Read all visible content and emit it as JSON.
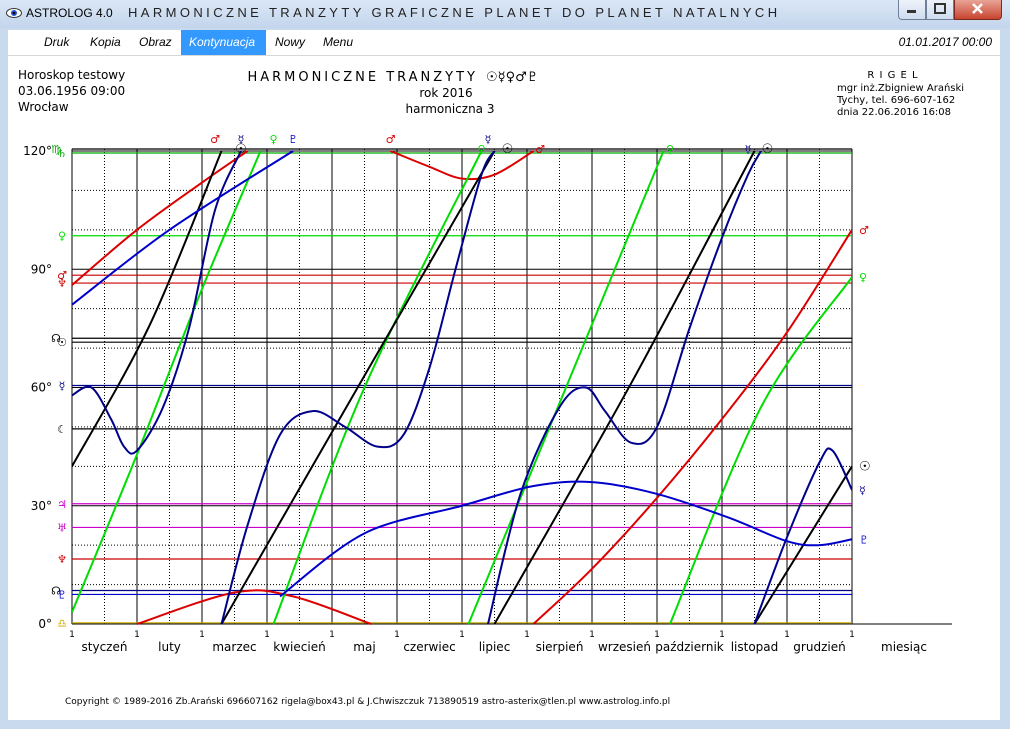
{
  "window": {
    "app_name": "ASTROLOG 4.0",
    "title": "HARMONICZNE TRANZYTY GRAFICZNE PLANET DO PLANET NATALNYCH",
    "minimize_glyph": "—",
    "maximize_glyph": "□",
    "close_glyph": "✕"
  },
  "menu": {
    "items": [
      {
        "label": "Druk"
      },
      {
        "label": "Kopia"
      },
      {
        "label": "Obraz"
      },
      {
        "label": "Kontynuacja",
        "active": true
      },
      {
        "label": "Nowy"
      },
      {
        "label": "Menu"
      }
    ],
    "datetime": "01.01.2017  00:00"
  },
  "header": {
    "left": [
      "Horoskop testowy",
      "03.06.1956  09:00",
      "Wrocław"
    ],
    "center_title": "HARMONICZNE  TRANZYTY",
    "center_title_glyphs": "☉☿♀♂♇",
    "center_year": "rok  2016",
    "center_harmonic": "harmoniczna 3",
    "right": [
      "R I G E L",
      "mgr inż.Zbigniew Arański",
      "Tychy, tel. 696-607-162",
      "dnia 22.06.2016  16:08"
    ]
  },
  "footer": {
    "copyright": "Copyright © 1989-2016 Zb.Arański 696607162 rigela@box43.pl & J.Chwiszczuk 713890519 astro-asterix@tlen.pl www.astrolog.info.pl"
  },
  "colors": {
    "sun": "#000000",
    "moon": "#000000",
    "mercury": "#00008b",
    "venus": "#00dd00",
    "mars": "#dd0000",
    "pluto": "#0000cc",
    "jupiter": "#cc00cc",
    "saturn": "#00aa00",
    "uranus": "#cc00cc",
    "neptune": "#cc0000",
    "node": "#cc00cc",
    "asc": "#ccaa00"
  },
  "chart_data": {
    "type": "line",
    "x_unit": "month",
    "xlim": [
      0,
      12
    ],
    "ylim": [
      0,
      120
    ],
    "grid": true,
    "xlabel": "miesiąc",
    "y_ticks": [
      {
        "value": 0,
        "label": "0°"
      },
      {
        "value": 30,
        "label": "30°"
      },
      {
        "value": 60,
        "label": "60°"
      },
      {
        "value": 90,
        "label": "90°"
      },
      {
        "value": 120,
        "label": "120°"
      }
    ],
    "x_tick_label": "1",
    "months": [
      "styczeń",
      "luty",
      "marzec",
      "kwiecień",
      "maj",
      "czerwiec",
      "lipiec",
      "sierpień",
      "wrzesień",
      "październik",
      "listopad",
      "grudzień"
    ],
    "natal_lines": [
      {
        "value": 120.5,
        "color": "#000000",
        "glyph": "♍",
        "glyph_color": "#00aa00",
        "label_x_offset": -6
      },
      {
        "value": 119.5,
        "color": "#00aa00",
        "glyph": "♄",
        "glyph_color": "#00aa00"
      },
      {
        "value": 98.5,
        "color": "#00dd00",
        "glyph": "♀",
        "glyph_color": "#00dd00"
      },
      {
        "value": 88.5,
        "color": "#cc0000",
        "glyph": "♂",
        "glyph_color": "#cc0000"
      },
      {
        "value": 86.5,
        "color": "#cc0000",
        "glyph": "♆",
        "glyph_color": "#cc0000"
      },
      {
        "value": 72.5,
        "color": "#000000",
        "glyph": "☊",
        "glyph_color": "#000000",
        "label_x_offset": -6
      },
      {
        "value": 71.5,
        "color": "#000000",
        "glyph": "☉",
        "glyph_color": "#000000"
      },
      {
        "value": 60.5,
        "color": "#00008b",
        "glyph": "☿",
        "glyph_color": "#00008b"
      },
      {
        "value": 49.5,
        "color": "#000000",
        "glyph": "☾",
        "glyph_color": "#000000"
      },
      {
        "value": 30.5,
        "color": "#cc00cc",
        "glyph": "♃",
        "glyph_color": "#cc00cc"
      },
      {
        "value": 24.5,
        "color": "#cc00cc",
        "glyph": "♅",
        "glyph_color": "#cc00cc"
      },
      {
        "value": 16.5,
        "color": "#cc0000",
        "glyph": "♆",
        "glyph_color": "#cc0000"
      },
      {
        "value": 8.5,
        "color": "#000080",
        "glyph": "☊",
        "glyph_color": "#000000",
        "label_x_offset": -6
      },
      {
        "value": 7.5,
        "color": "#0000cc",
        "glyph": "♇",
        "glyph_color": "#0000cc"
      },
      {
        "value": 0.3,
        "color": "#ccaa00",
        "glyph": "♎",
        "glyph_color": "#ccaa00"
      }
    ],
    "series": [
      {
        "planet": "mars",
        "glyph": "♂",
        "color": "#dd0000",
        "segments": [
          [
            [
              0,
              86
            ],
            [
              1,
              100
            ],
            [
              2,
              112
            ],
            [
              2.7,
              120
            ]
          ],
          [
            [
              4.9,
              120
            ],
            [
              5.5,
              116
            ],
            [
              6.0,
              113
            ],
            [
              6.5,
              114
            ],
            [
              7.1,
              120
            ]
          ],
          [
            [
              1.0,
              0
            ],
            [
              2.5,
              8
            ],
            [
              3.4,
              7
            ],
            [
              4.6,
              0
            ]
          ],
          [
            [
              7.1,
              0
            ],
            [
              8.0,
              14
            ],
            [
              9.0,
              32
            ],
            [
              10.0,
              52
            ],
            [
              11.0,
              74
            ],
            [
              12.0,
              100
            ]
          ]
        ]
      },
      {
        "planet": "venus",
        "glyph": "♀",
        "color": "#00dd00",
        "segments": [
          [
            [
              0,
              3
            ],
            [
              1,
              43
            ],
            [
              2,
              85
            ],
            [
              2.9,
              120
            ]
          ],
          [
            [
              3.1,
              0
            ],
            [
              4.5,
              60
            ],
            [
              6.3,
              120
            ]
          ],
          [
            [
              6.1,
              0
            ],
            [
              7.6,
              60
            ],
            [
              9.1,
              120
            ]
          ],
          [
            [
              9.2,
              0
            ],
            [
              10.6,
              55
            ],
            [
              12.0,
              88
            ]
          ]
        ]
      },
      {
        "planet": "sun",
        "glyph": "☉",
        "color": "#000000",
        "segments": [
          [
            [
              0,
              40
            ],
            [
              1.2,
              76
            ],
            [
              2.3,
              120
            ]
          ],
          [
            [
              2.3,
              0
            ],
            [
              4.5,
              63
            ],
            [
              6.5,
              120
            ]
          ],
          [
            [
              6.5,
              0
            ],
            [
              8.6,
              61
            ],
            [
              10.5,
              120
            ]
          ],
          [
            [
              10.5,
              0
            ],
            [
              12.0,
              40
            ]
          ]
        ]
      },
      {
        "planet": "mercury",
        "glyph": "☿",
        "color": "#00008b",
        "segments": [
          [
            [
              0,
              58
            ],
            [
              0.3,
              60
            ],
            [
              0.6,
              52
            ],
            [
              0.8,
              45
            ],
            [
              1.0,
              44
            ],
            [
              1.4,
              55
            ],
            [
              1.8,
              75
            ],
            [
              2.2,
              105
            ],
            [
              2.6,
              120
            ]
          ],
          [
            [
              2.3,
              0
            ],
            [
              2.7,
              25
            ],
            [
              3.2,
              48
            ],
            [
              3.7,
              54
            ],
            [
              4.2,
              50
            ],
            [
              4.7,
              45
            ],
            [
              5.1,
              48
            ],
            [
              5.5,
              65
            ],
            [
              5.9,
              90
            ],
            [
              6.3,
              114
            ],
            [
              6.5,
              120
            ]
          ],
          [
            [
              6.4,
              0
            ],
            [
              6.9,
              33
            ],
            [
              7.5,
              55
            ],
            [
              7.9,
              60
            ],
            [
              8.2,
              54
            ],
            [
              8.6,
              46
            ],
            [
              9.0,
              50
            ],
            [
              9.5,
              75
            ],
            [
              10.0,
              98
            ],
            [
              10.4,
              114
            ],
            [
              10.6,
              120
            ]
          ],
          [
            [
              10.5,
              0
            ],
            [
              11.0,
              22
            ],
            [
              11.5,
              41
            ],
            [
              11.7,
              44
            ],
            [
              12.0,
              34
            ]
          ]
        ]
      },
      {
        "planet": "pluto",
        "glyph": "♇",
        "color": "#0000cc",
        "segments": [
          [
            [
              0,
              81
            ],
            [
              1.5,
              100
            ],
            [
              3.4,
              120
            ]
          ],
          [
            [
              3.2,
              7
            ],
            [
              4.5,
              23
            ],
            [
              6.0,
              30
            ],
            [
              7.1,
              35
            ],
            [
              8.0,
              36
            ],
            [
              9.0,
              33
            ],
            [
              10.1,
              27
            ],
            [
              11.0,
              21
            ],
            [
              11.5,
              20
            ],
            [
              12.0,
              21.5
            ]
          ]
        ]
      }
    ],
    "top_glyphs": [
      {
        "x": 2.2,
        "glyph": "♂",
        "color": "#dd0000",
        "font_size": 11
      },
      {
        "x": 2.6,
        "glyph": "☿",
        "color": "#00008b",
        "font_size": 11
      },
      {
        "x": 2.6,
        "glyph": "☉",
        "color": "#000000",
        "font_size": 13,
        "y_offset": 10
      },
      {
        "x": 3.1,
        "glyph": "♀",
        "color": "#00dd00",
        "font_size": 11
      },
      {
        "x": 3.4,
        "glyph": "♇",
        "color": "#0000cc",
        "font_size": 11
      },
      {
        "x": 4.9,
        "glyph": "♂",
        "color": "#dd0000",
        "font_size": 11
      },
      {
        "x": 6.4,
        "glyph": "☿",
        "color": "#00008b",
        "font_size": 11
      },
      {
        "x": 6.3,
        "glyph": "♀",
        "color": "#00dd00",
        "font_size": 11,
        "y_offset": 10
      },
      {
        "x": 6.7,
        "glyph": "☉",
        "color": "#000000",
        "font_size": 13,
        "y_offset": 10
      },
      {
        "x": 7.2,
        "glyph": "♂",
        "color": "#dd0000",
        "font_size": 11,
        "y_offset": 10
      },
      {
        "x": 9.2,
        "glyph": "♀",
        "color": "#00dd00",
        "font_size": 11,
        "y_offset": 10
      },
      {
        "x": 10.4,
        "glyph": "☿",
        "color": "#00008b",
        "font_size": 11,
        "y_offset": 10
      },
      {
        "x": 10.7,
        "glyph": "☉",
        "color": "#000000",
        "font_size": 13,
        "y_offset": 10
      }
    ],
    "right_glyphs": [
      {
        "value": 100,
        "glyph": "♂",
        "color": "#dd0000",
        "font_size": 11
      },
      {
        "value": 88,
        "glyph": "♀",
        "color": "#00dd00",
        "font_size": 11
      },
      {
        "value": 40,
        "glyph": "☉",
        "color": "#000000",
        "font_size": 13
      },
      {
        "value": 34,
        "glyph": "☿",
        "color": "#00008b",
        "font_size": 11
      },
      {
        "value": 21.5,
        "glyph": "♇",
        "color": "#0000cc",
        "font_size": 11
      }
    ]
  }
}
